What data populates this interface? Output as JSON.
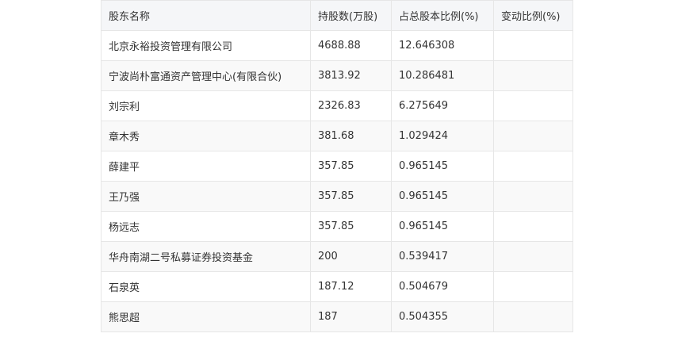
{
  "table": {
    "headers": [
      "股东名称",
      "持股数(万股)",
      "占总股本比例(%)",
      "变动比例(%)"
    ],
    "rows": [
      [
        "北京永裕投资管理有限公司",
        "4688.88",
        "12.646308",
        ""
      ],
      [
        "宁波尚朴富通资产管理中心(有限合伙)",
        "3813.92",
        "10.286481",
        ""
      ],
      [
        "刘宗利",
        "2326.83",
        "6.275649",
        ""
      ],
      [
        "章木秀",
        "381.68",
        "1.029424",
        ""
      ],
      [
        "薛建平",
        "357.85",
        "0.965145",
        ""
      ],
      [
        "王乃强",
        "357.85",
        "0.965145",
        ""
      ],
      [
        "杨远志",
        "357.85",
        "0.965145",
        ""
      ],
      [
        "华舟南湖二号私募证券投资基金",
        "200",
        "0.539417",
        ""
      ],
      [
        "石泉英",
        "187.12",
        "0.504679",
        ""
      ],
      [
        "熊思超",
        "187",
        "0.504355",
        ""
      ]
    ]
  }
}
